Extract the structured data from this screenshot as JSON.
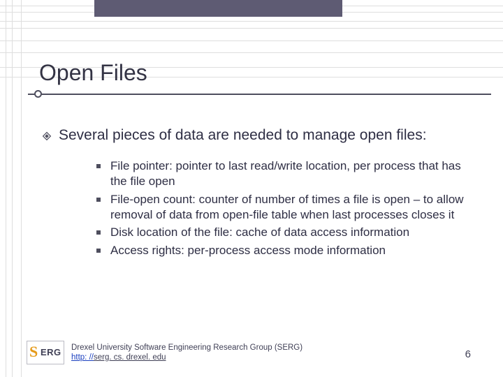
{
  "title": "Open Files",
  "main_bullet": "Several pieces of data are needed to manage open files:",
  "sub_bullets": [
    "File pointer:  pointer to last read/write location, per process that has the file open",
    "File-open count: counter of number of times a file is open – to allow removal of data from open-file table when last processes closes it",
    "Disk location of the file: cache of data access information",
    "Access rights: per-process access mode information"
  ],
  "footer": {
    "org": "Drexel University Software Engineering Research Group (SERG)",
    "link_prefix": "http: //",
    "link_rest": "serg. cs. drexel. edu"
  },
  "slide_number": "6",
  "bg": {
    "hlines": [
      8,
      17,
      30,
      40,
      58,
      75,
      96,
      110
    ],
    "vlines": [
      8,
      17,
      30
    ]
  },
  "logo": {
    "s": "S",
    "erg": "ERG"
  }
}
